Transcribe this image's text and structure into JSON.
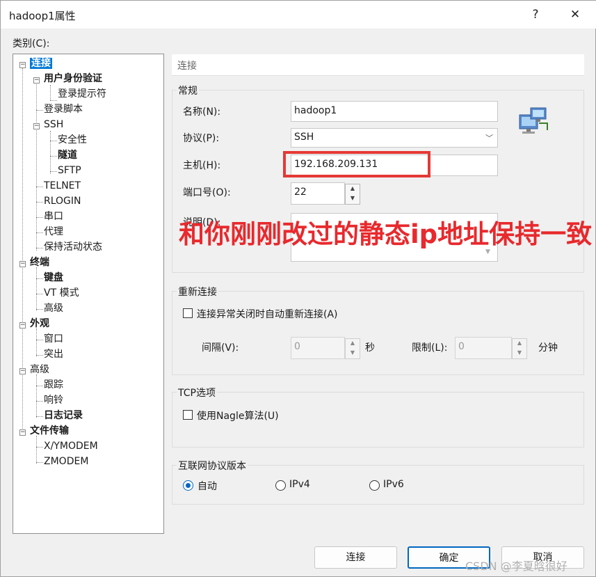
{
  "window": {
    "title": "hadoop1属性",
    "help_glyph": "?",
    "close_glyph": "✕"
  },
  "category_label": "类别(C):",
  "tree": {
    "items": [
      {
        "label": "连接",
        "selected": true,
        "bold": true
      },
      {
        "label": "用户身份验证",
        "bold": true
      },
      {
        "label": "登录提示符"
      },
      {
        "label": "登录脚本"
      },
      {
        "label": "SSH"
      },
      {
        "label": "安全性"
      },
      {
        "label": "隧道",
        "bold": true
      },
      {
        "label": "SFTP"
      },
      {
        "label": "TELNET"
      },
      {
        "label": "RLOGIN"
      },
      {
        "label": "串口"
      },
      {
        "label": "代理"
      },
      {
        "label": "保持活动状态"
      },
      {
        "label": "终端",
        "bold": true
      },
      {
        "label": "键盘",
        "bold": true
      },
      {
        "label": "VT 模式"
      },
      {
        "label": "高级"
      },
      {
        "label": "外观",
        "bold": true
      },
      {
        "label": "窗口"
      },
      {
        "label": "突出"
      },
      {
        "label": "高级"
      },
      {
        "label": "跟踪"
      },
      {
        "label": "响铃"
      },
      {
        "label": "日志记录",
        "bold": true
      },
      {
        "label": "文件传输",
        "bold": true
      },
      {
        "label": "X/YMODEM"
      },
      {
        "label": "ZMODEM"
      }
    ]
  },
  "panel": {
    "header": "连接",
    "general": {
      "title": "常规",
      "name_label": "名称(N):",
      "name_value": "hadoop1",
      "protocol_label": "协议(P):",
      "protocol_value": "SSH",
      "host_label": "主机(H):",
      "host_value": "192.168.209.131",
      "port_label": "端口号(O):",
      "port_value": "22",
      "desc_label": "说明(D):",
      "desc_value": ""
    },
    "reconnect": {
      "title": "重新连接",
      "checkbox_label": "连接异常关闭时自动重新连接(A)",
      "interval_label": "间隔(V):",
      "interval_value": "0",
      "interval_unit": "秒",
      "limit_label": "限制(L):",
      "limit_value": "0",
      "limit_unit": "分钟"
    },
    "tcp": {
      "title": "TCP选项",
      "nagle_label": "使用Nagle算法(U)"
    },
    "ipver": {
      "title": "互联网协议版本",
      "options": [
        "自动",
        "IPv4",
        "IPv6"
      ],
      "selected": "自动"
    }
  },
  "buttons": {
    "connect": "连接",
    "ok": "确定",
    "cancel": "取消"
  },
  "annotation": "和你刚刚改过的静态ip地址保持一致",
  "watermark": "CSDN @李夏晗很好",
  "colors": {
    "annotation": "#e8292d",
    "selection": "#0078d7",
    "accent": "#0067c0"
  }
}
